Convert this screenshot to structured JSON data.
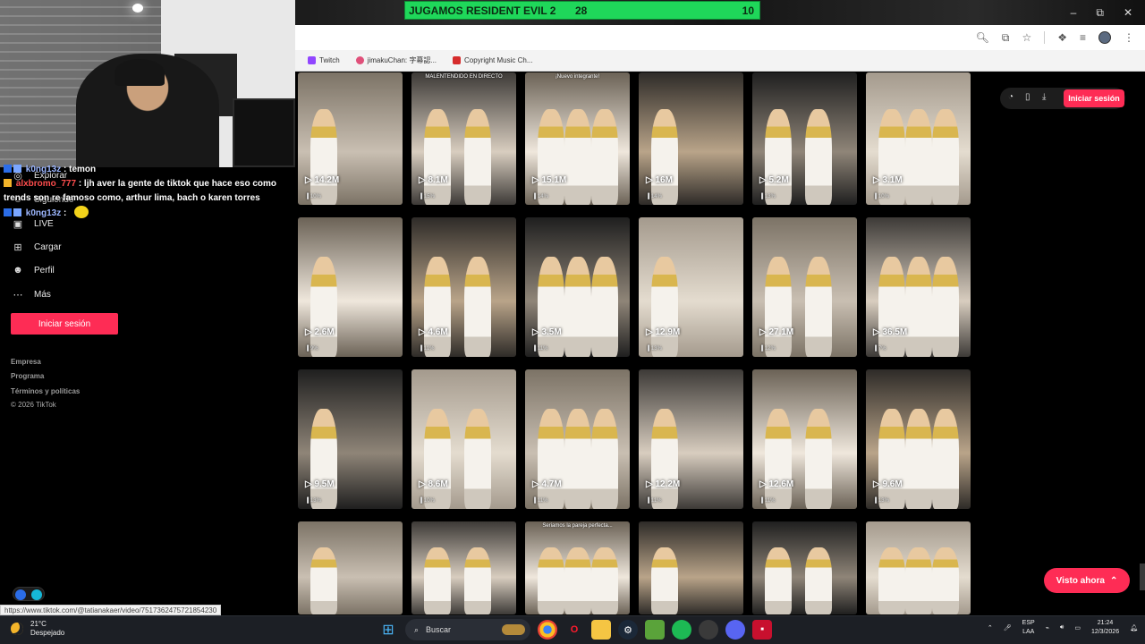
{
  "stream_overlay": {
    "title": "JUGAMOS RESIDENT EVIL 2",
    "score_a": "28",
    "score_b": "10"
  },
  "window_controls": {
    "min": "–",
    "max": "⧉",
    "close": "✕"
  },
  "bookmarks": [
    {
      "label": "Twitch",
      "color": "#9146ff"
    },
    {
      "label": "jimakuChan: 字幕認...",
      "color": "#e0507a"
    },
    {
      "label": "Copyright Music Ch...",
      "color": "#d62c2c"
    }
  ],
  "sidebar": {
    "items": [
      {
        "label": "Explorar",
        "icon": "compass-icon"
      },
      {
        "label": "Siguiendo",
        "icon": "users-icon"
      },
      {
        "label": "LIVE",
        "icon": "live-icon"
      },
      {
        "label": "Cargar",
        "icon": "upload-icon"
      },
      {
        "label": "Perfil",
        "icon": "profile-icon"
      },
      {
        "label": "Más",
        "icon": "more-icon"
      }
    ],
    "login_label": "Iniciar sesión",
    "footer": [
      "Empresa",
      "Programa",
      "Términos y políticas"
    ],
    "copyright": "© 2026 TikTok"
  },
  "chat": [
    {
      "user": "k0ng13z",
      "msg": ": temon",
      "color": "#9db7ff"
    },
    {
      "user": "alxbromo_777",
      "msg": ": ljh aver la gente de tiktok que hace eso como trends son re famoso como, arthur lima, bach o karen torres",
      "color": "#ff4d4d"
    },
    {
      "user": "k0ng13z",
      "msg": ":",
      "color": "#9db7ff"
    }
  ],
  "grid": {
    "rows": [
      [
        {
          "views": "14.2M",
          "pct": "10%",
          "caption": ""
        },
        {
          "views": "8.1M",
          "pct": "15%",
          "caption": "MALENTENDIDO EN DIRECTO"
        },
        {
          "views": "15.1M",
          "pct": "14%",
          "caption": "¡Nuevo integrante!"
        },
        {
          "views": "16M",
          "pct": "14%",
          "caption": ""
        },
        {
          "views": "5.2M",
          "pct": "13%",
          "caption": ""
        },
        {
          "views": "3.1M",
          "pct": "10%",
          "caption": ""
        }
      ],
      [
        {
          "views": "2.6M",
          "pct": "9%",
          "caption": ""
        },
        {
          "views": "4.6M",
          "pct": "11%",
          "caption": ""
        },
        {
          "views": "3.5M",
          "pct": "11%",
          "caption": ""
        },
        {
          "views": "12.9M",
          "pct": "13%",
          "caption": ""
        },
        {
          "views": "27.1M",
          "pct": "12%",
          "caption": ""
        },
        {
          "views": "36.5M",
          "pct": "7%",
          "caption": ""
        }
      ],
      [
        {
          "views": "9.5M",
          "pct": "13%",
          "caption": ""
        },
        {
          "views": "8.6M",
          "pct": "10%",
          "caption": ""
        },
        {
          "views": "4.7M",
          "pct": "11%",
          "caption": ""
        },
        {
          "views": "12.2M",
          "pct": "11%",
          "caption": ""
        },
        {
          "views": "12.6M",
          "pct": "11%",
          "caption": ""
        },
        {
          "views": "9.6M",
          "pct": "13%",
          "caption": ""
        }
      ],
      [
        {
          "views": "",
          "pct": "",
          "caption": ""
        },
        {
          "views": "",
          "pct": "",
          "caption": ""
        },
        {
          "views": "",
          "pct": "",
          "caption": "Seriamos la pareja perfecta..."
        },
        {
          "views": "",
          "pct": "",
          "caption": ""
        },
        {
          "views": "",
          "pct": "",
          "caption": ""
        },
        {
          "views": "",
          "pct": "",
          "caption": ""
        }
      ]
    ]
  },
  "right": {
    "login_label": "Iniciar sesión",
    "watch_now": "Visto ahora"
  },
  "status_url": "https://www.tiktok.com/@tatianakaer/video/7517362475721854230",
  "taskbar": {
    "temp": "21°C",
    "weather": "Despejado",
    "search": "Buscar",
    "lang_top": "ESP",
    "lang_bottom": "LAA",
    "time": "21:24",
    "date": "12/3/2026"
  }
}
